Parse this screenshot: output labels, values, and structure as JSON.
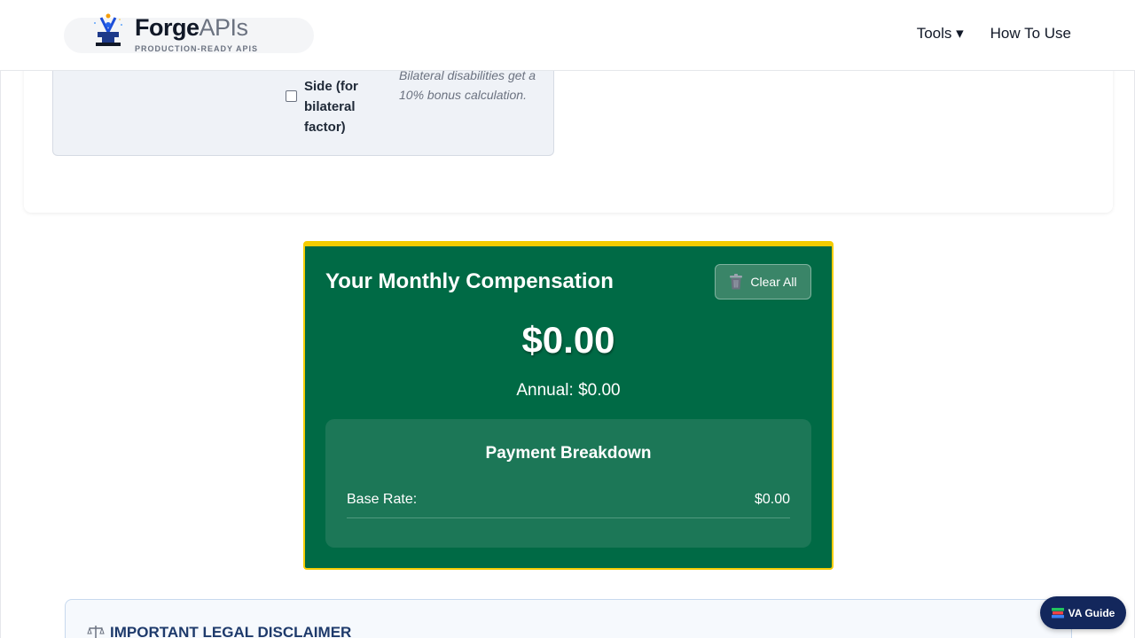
{
  "header": {
    "brand_name_main": "Forge",
    "brand_name_accent": "APIs",
    "brand_tagline": "PRODUCTION-READY APIS",
    "nav": [
      {
        "label": "Tools ▾"
      },
      {
        "label": "How To Use"
      }
    ]
  },
  "form": {
    "bilateral_label": "Side (for bilateral factor)",
    "bilateral_help": "Bilateral disabilities get a 10% bonus calculation."
  },
  "compensation": {
    "title": "Your Monthly Compensation",
    "clear_button_label": "Clear All",
    "monthly_amount": "$0.00",
    "annual_text": "Annual: $0.00",
    "breakdown": {
      "title": "Payment Breakdown",
      "rows": [
        {
          "label": "Base Rate:",
          "value": "$0.00"
        }
      ]
    }
  },
  "disclaimer": {
    "title": "IMPORTANT LEGAL DISCLAIMER"
  },
  "guide_button": {
    "label": "VA Guide"
  },
  "colors": {
    "card_green": "#006a45",
    "card_border_gold": "#f5cc00",
    "breakdown_green": "#1c7757",
    "guide_navy": "#13275c"
  }
}
